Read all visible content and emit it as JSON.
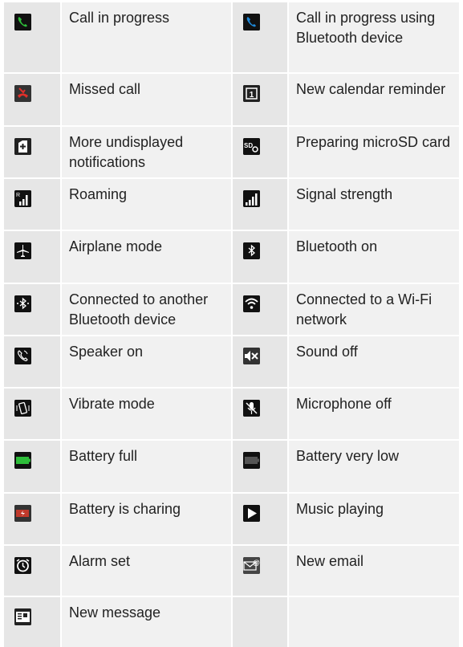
{
  "rows": [
    {
      "left": {
        "icon": "call-in-progress-icon",
        "label": "Call in progress"
      },
      "right": {
        "icon": "call-bluetooth-icon",
        "label": "Call in progress using Bluetooth device"
      }
    },
    {
      "left": {
        "icon": "missed-call-icon",
        "label": "Missed call"
      },
      "right": {
        "icon": "calendar-reminder-icon",
        "label": "New calendar reminder"
      }
    },
    {
      "left": {
        "icon": "more-notifications-icon",
        "label": "More undisplayed notifications"
      },
      "right": {
        "icon": "microsd-preparing-icon",
        "label": "Preparing microSD card"
      }
    },
    {
      "left": {
        "icon": "roaming-icon",
        "label": "Roaming"
      },
      "right": {
        "icon": "signal-strength-icon",
        "label": "Signal strength"
      }
    },
    {
      "left": {
        "icon": "airplane-mode-icon",
        "label": "Airplane mode"
      },
      "right": {
        "icon": "bluetooth-on-icon",
        "label": "Bluetooth on"
      }
    },
    {
      "left": {
        "icon": "bluetooth-connected-icon",
        "label": "Connected to another Bluetooth device"
      },
      "right": {
        "icon": "wifi-connected-icon",
        "label": "Connected to a Wi-Fi network"
      }
    },
    {
      "left": {
        "icon": "speaker-on-icon",
        "label": "Speaker on"
      },
      "right": {
        "icon": "sound-off-icon",
        "label": "Sound off"
      }
    },
    {
      "left": {
        "icon": "vibrate-mode-icon",
        "label": "Vibrate mode"
      },
      "right": {
        "icon": "microphone-off-icon",
        "label": "Microphone off"
      }
    },
    {
      "left": {
        "icon": "battery-full-icon",
        "label": "Battery full"
      },
      "right": {
        "icon": "battery-very-low-icon",
        "label": "Battery very low"
      }
    },
    {
      "left": {
        "icon": "battery-charging-icon",
        "label": "Battery is charing"
      },
      "right": {
        "icon": "music-playing-icon",
        "label": "Music playing"
      }
    },
    {
      "left": {
        "icon": "alarm-set-icon",
        "label": "Alarm set"
      },
      "right": {
        "icon": "new-email-icon",
        "label": "New email"
      }
    },
    {
      "left": {
        "icon": "new-message-icon",
        "label": "New message"
      },
      "right": {
        "icon": "",
        "label": ""
      }
    }
  ],
  "colors": {
    "icon_cell": "#e6e6e6",
    "text_cell": "#f1f1f1",
    "green": "#2ebd3a",
    "blue": "#1e88d8",
    "red": "#e0302a"
  }
}
